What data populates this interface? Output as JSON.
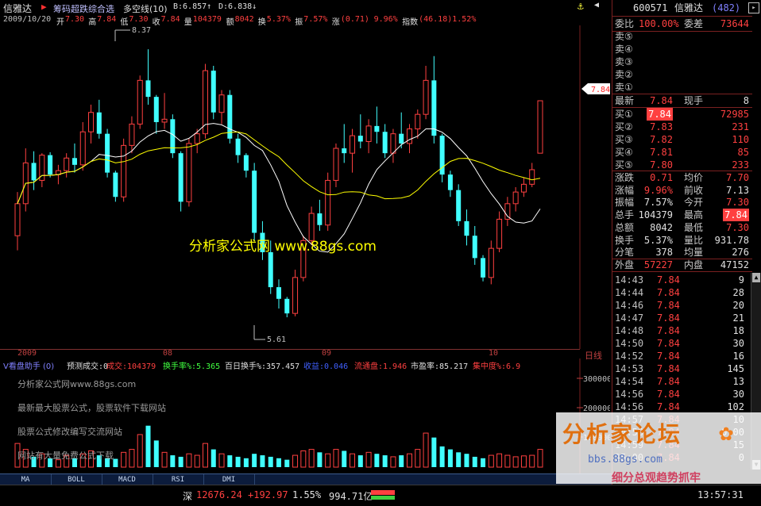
{
  "header": {
    "stock_name": "信雅达",
    "indicator_name": "筹码超跌综合选",
    "line_name": "多空线(10)",
    "b_value": "B:6.857↑",
    "d_value": "D:6.838↓"
  },
  "quote_line": {
    "date": "2009/10/20",
    "items": [
      {
        "label": "开",
        "value": "7.30"
      },
      {
        "label": "高",
        "value": "7.84"
      },
      {
        "label": "低",
        "value": "7.30"
      },
      {
        "label": "收",
        "value": "7.84"
      },
      {
        "label": "量",
        "value": "104379"
      },
      {
        "label": "额",
        "value": "8042"
      },
      {
        "label": "换",
        "value": "5.37%"
      },
      {
        "label": "振",
        "value": "7.57%"
      },
      {
        "label": "涨",
        "value": "(0.71)"
      },
      {
        "label": "",
        "value": "9.96%"
      },
      {
        "label": "指数",
        "value": "(46.18)1.52%"
      }
    ]
  },
  "main_chart": {
    "high_marker": "8.37",
    "low_marker": "5.61",
    "current_price_tag": "7.84",
    "watermark": "分析家公式网 www.88gs.com"
  },
  "date_axis": {
    "labels": [
      "2009",
      "08",
      "09",
      "10"
    ],
    "right_label": "日线"
  },
  "volume_panel": {
    "title": "V看盘助手 (0)",
    "items": [
      {
        "text": "预测成交:0",
        "color": "#e0e0e0"
      },
      {
        "text": "成交:104379",
        "color": "#ff4040"
      },
      {
        "text": "换手率%:5.365",
        "color": "#40ff40"
      },
      {
        "text": "百日换手%:357.457",
        "color": "#e0e0e0"
      },
      {
        "text": "收益:0.046",
        "color": "#4060ff"
      },
      {
        "text": "流通盘:1.946",
        "color": "#ff4040"
      },
      {
        "text": "市盈率:85.217",
        "color": "#e0e0e0"
      },
      {
        "text": "集中度%:6.9",
        "color": "#ff4040"
      }
    ],
    "wm1": "分析家公式网www.88gs.com",
    "wm2": "最新最大股票公式，股票软件下载网站",
    "wm3": "股票公式修改编写交流网站",
    "wm4": "网站有大量免费公式下载",
    "axis_300000": "300000",
    "axis_200000": "200000",
    "axis_100000": "100000"
  },
  "tabs": [
    "MA",
    "BOLL",
    "MACD",
    "RSI",
    "DMI"
  ],
  "status": {
    "market": "深",
    "index": "12676.24",
    "change": "+192.97",
    "pct": "1.55%",
    "amount": "994.71亿",
    "time": "13:57:31"
  },
  "right_panel": {
    "code": "600571",
    "name": "信雅达",
    "num": "(482)",
    "weibi_label": "委比",
    "weibi_value": "100.00%",
    "weicha_label": "委差",
    "weicha_value": "73644",
    "sells": [
      "卖⑤",
      "卖④",
      "卖③",
      "卖②",
      "卖①"
    ],
    "latest_label": "最新",
    "latest_value": "7.84",
    "xianshou_label": "现手",
    "xianshou_value": "8",
    "buys": [
      {
        "label": "买①",
        "price": "7.84",
        "vol": "72985"
      },
      {
        "label": "买②",
        "price": "7.83",
        "vol": "231"
      },
      {
        "label": "买③",
        "price": "7.82",
        "vol": "110"
      },
      {
        "label": "买④",
        "price": "7.81",
        "vol": "85"
      },
      {
        "label": "买⑤",
        "price": "7.80",
        "vol": "233"
      }
    ],
    "stats": [
      {
        "l1": "涨跌",
        "v1": "0.71",
        "l2": "均价",
        "v2": "7.70",
        "c1": "red",
        "c2": "red"
      },
      {
        "l1": "涨幅",
        "v1": "9.96%",
        "l2": "前收",
        "v2": "7.13",
        "c1": "red",
        "c2": "wht"
      },
      {
        "l1": "振幅",
        "v1": "7.57%",
        "l2": "今开",
        "v2": "7.30",
        "c1": "wht",
        "c2": "red"
      },
      {
        "l1": "总手",
        "v1": "104379",
        "l2": "最高",
        "v2": "7.84",
        "c1": "wht",
        "c2": "hl"
      },
      {
        "l1": "总额",
        "v1": "8042",
        "l2": "最低",
        "v2": "7.30",
        "c1": "wht",
        "c2": "red"
      },
      {
        "l1": "换手",
        "v1": "5.37%",
        "l2": "量比",
        "v2": "931.78",
        "c1": "wht",
        "c2": "wht"
      },
      {
        "l1": "分笔",
        "v1": "378",
        "l2": "均量",
        "v2": "276",
        "c1": "wht",
        "c2": "wht"
      }
    ],
    "waipan_label": "外盘",
    "waipan_value": "57227",
    "neipan_label": "内盘",
    "neipan_value": "47152",
    "ticks": [
      {
        "t": "14:43",
        "p": "7.84",
        "v": "9"
      },
      {
        "t": "14:44",
        "p": "7.84",
        "v": "28"
      },
      {
        "t": "14:46",
        "p": "7.84",
        "v": "20"
      },
      {
        "t": "14:47",
        "p": "7.84",
        "v": "21"
      },
      {
        "t": "14:48",
        "p": "7.84",
        "v": "18"
      },
      {
        "t": "14:50",
        "p": "7.84",
        "v": "30"
      },
      {
        "t": "14:52",
        "p": "7.84",
        "v": "16"
      },
      {
        "t": "14:53",
        "p": "7.84",
        "v": "145"
      },
      {
        "t": "14:54",
        "p": "7.84",
        "v": "13"
      },
      {
        "t": "14:56",
        "p": "7.84",
        "v": "30"
      },
      {
        "t": "14:56",
        "p": "7.84",
        "v": "102"
      },
      {
        "t": "14:57",
        "p": "7.84",
        "v": "10"
      },
      {
        "t": "14:58",
        "p": "7.84",
        "v": "0.00"
      },
      {
        "t": "14:59",
        "p": "7.84",
        "v": "15"
      },
      {
        "t": "15:00",
        "p": "7.84",
        "v": "0"
      }
    ],
    "forum_brand": "分析家论坛",
    "forum_url": "bbs.88gs.com",
    "forum_slogan": "细分总观趋势抓牢"
  },
  "colors": {
    "up": "#ff4040",
    "down": "#40ffff",
    "ma_white": "#ffffff",
    "ma_yellow": "#ffff00",
    "frame": "#7a2020"
  },
  "chart_data": {
    "type": "candlestick",
    "price_range": [
      5.3,
      8.6
    ],
    "x_labels": [
      "2009",
      "08",
      "09",
      "10"
    ],
    "highest": 8.37,
    "lowest": 5.61,
    "last": 7.84
  }
}
